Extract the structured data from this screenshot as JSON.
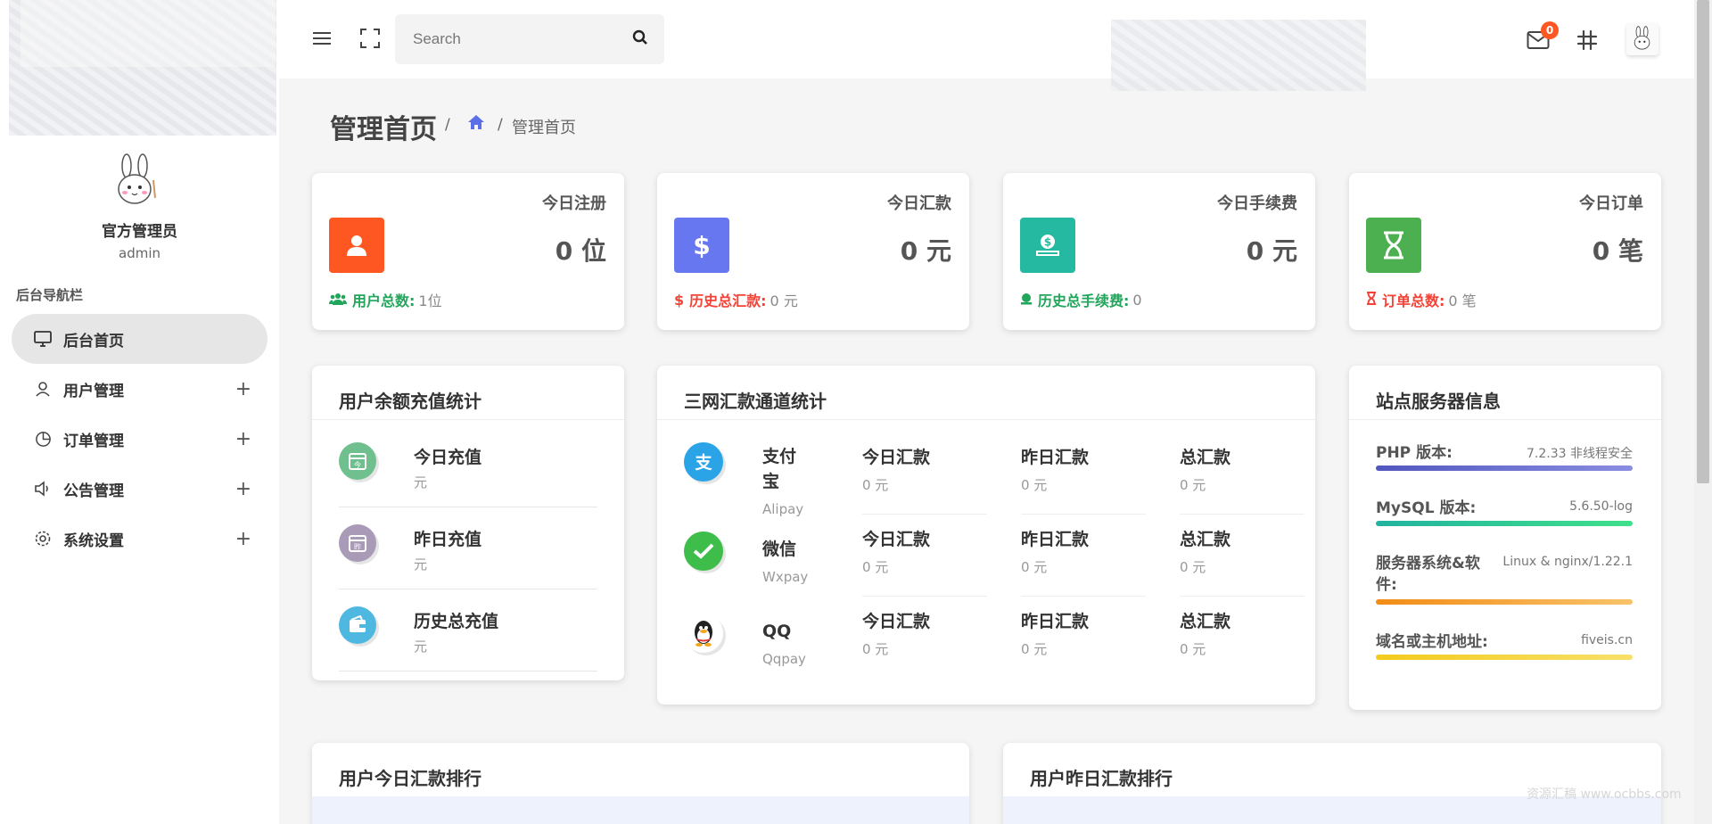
{
  "sidebar": {
    "user_name": "官方管理员",
    "user_role": "admin",
    "nav_heading": "后台导航栏",
    "items": [
      {
        "label": "后台首页",
        "icon": "monitor-icon",
        "expandable": false,
        "active": true
      },
      {
        "label": "用户管理",
        "icon": "user-icon",
        "expandable": true,
        "active": false
      },
      {
        "label": "订单管理",
        "icon": "pie-chart-icon",
        "expandable": true,
        "active": false
      },
      {
        "label": "公告管理",
        "icon": "speaker-icon",
        "expandable": true,
        "active": false
      },
      {
        "label": "系统设置",
        "icon": "gear-icon",
        "expandable": true,
        "active": false
      }
    ],
    "expand_symbol": "+"
  },
  "topbar": {
    "search_placeholder": "Search",
    "mail_badge": "0"
  },
  "page": {
    "title": "管理首页",
    "breadcrumb_separator": "/",
    "breadcrumb_current": "管理首页"
  },
  "stats": [
    {
      "title": "今日注册",
      "value": "0 位",
      "color": "#ff5722",
      "foot_label": "用户总数:",
      "foot_value": "1位",
      "foot_color": "#22a65b"
    },
    {
      "title": "今日汇款",
      "value": "0 元",
      "color": "#6777ef",
      "foot_label": "历史总汇款:",
      "foot_value": "0 元",
      "foot_color": "#f44336"
    },
    {
      "title": "今日手续费",
      "value": "0 元",
      "color": "#26b9a2",
      "foot_label": "历史总手续费:",
      "foot_value": "0",
      "foot_color": "#22a65b"
    },
    {
      "title": "今日订单",
      "value": "0 笔",
      "color": "#4caf50",
      "foot_label": "订单总数:",
      "foot_value": "0 笔",
      "foot_color": "#f44336"
    }
  ],
  "recharge": {
    "title": "用户余额充值统计",
    "rows": [
      {
        "label": "今日充值",
        "unit": "元",
        "color": "#6fbf8f",
        "badge": "今"
      },
      {
        "label": "昨日充值",
        "unit": "元",
        "color": "#a99ab8",
        "badge": "昨"
      },
      {
        "label": "历史总充值",
        "unit": "元",
        "color": "#4fb8e0",
        "badge": ""
      }
    ]
  },
  "channels": {
    "title": "三网汇款通道统计",
    "rows": [
      {
        "name": "支付宝",
        "sub": "Alipay",
        "color": "#2aa4e6",
        "cols": [
          {
            "label": "今日汇款",
            "value": "0 元"
          },
          {
            "label": "昨日汇款",
            "value": "0 元"
          },
          {
            "label": "总汇款",
            "value": "0 元"
          }
        ]
      },
      {
        "name": "微信",
        "sub": "Wxpay",
        "color": "#3ebd4a",
        "cols": [
          {
            "label": "今日汇款",
            "value": "0 元"
          },
          {
            "label": "昨日汇款",
            "value": "0 元"
          },
          {
            "label": "总汇款",
            "value": "0 元"
          }
        ]
      },
      {
        "name": "QQ",
        "sub": "Qqpay",
        "color": "#222222",
        "cols": [
          {
            "label": "今日汇款",
            "value": "0 元"
          },
          {
            "label": "昨日汇款",
            "value": "0 元"
          },
          {
            "label": "总汇款",
            "value": "0 元"
          }
        ]
      }
    ]
  },
  "server": {
    "title": "站点服务器信息",
    "rows": [
      {
        "label": "PHP 版本:",
        "value": "7.2.33 非线程安全",
        "color": "#5b5fc7"
      },
      {
        "label": "MySQL 版本:",
        "value": "5.6.50-log",
        "color": "#2dc9a0"
      },
      {
        "label": "服务器系统&软件:",
        "value": "Linux & nginx/1.22.1",
        "color": "#f59a23"
      },
      {
        "label": "域名或主机地址:",
        "value": "fiveis.cn",
        "color": "#f6d12e"
      }
    ]
  },
  "ranking": {
    "today_title": "用户今日汇款排行",
    "yesterday_title": "用户昨日汇款排行"
  },
  "watermark": "资源汇稿 www.ocbbs.com"
}
